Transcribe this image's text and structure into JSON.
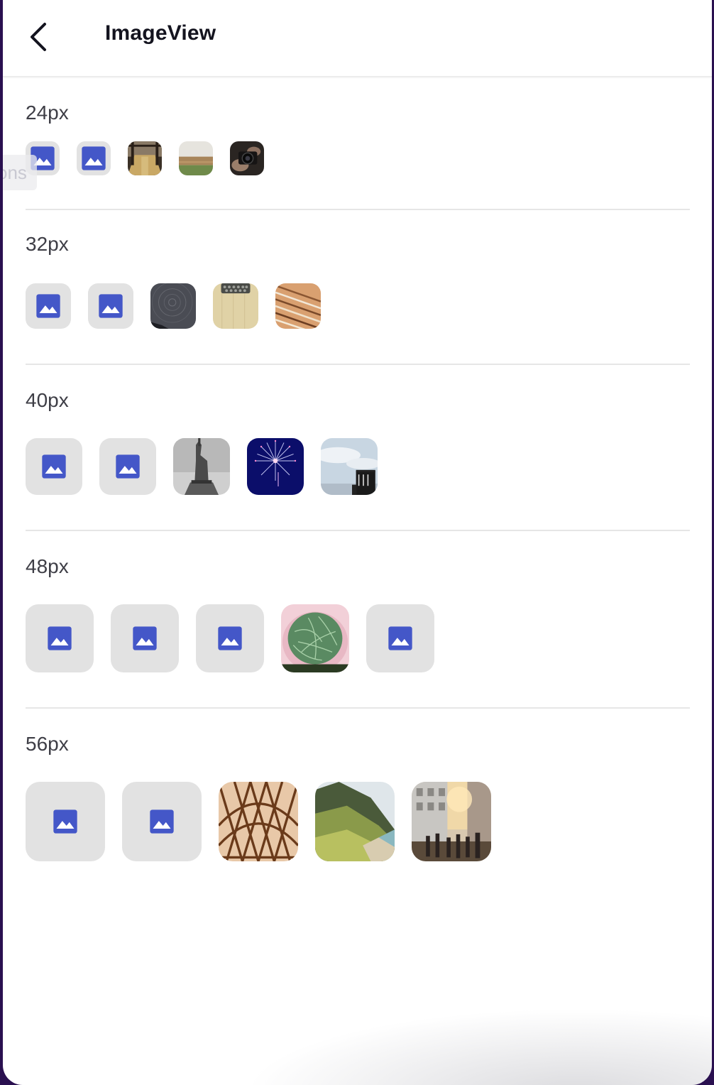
{
  "header": {
    "title": "ImageView",
    "back_icon": "chevron-left-icon"
  },
  "side_tab": {
    "text": "ons"
  },
  "colors": {
    "placeholder_icon": "#4457c8",
    "placeholder_bg": "#e2e2e2",
    "divider": "#e6e6e6",
    "label_text": "#3e3e46",
    "title_text": "#14141f"
  },
  "sections": [
    {
      "label": "24px",
      "items": [
        {
          "kind": "placeholder",
          "icon": "image-icon"
        },
        {
          "kind": "placeholder",
          "icon": "image-icon"
        },
        {
          "kind": "photo",
          "subject": "pier"
        },
        {
          "kind": "photo",
          "subject": "field"
        },
        {
          "kind": "photo",
          "subject": "camera"
        }
      ]
    },
    {
      "label": "32px",
      "items": [
        {
          "kind": "placeholder",
          "icon": "image-icon"
        },
        {
          "kind": "placeholder",
          "icon": "image-icon"
        },
        {
          "kind": "photo",
          "subject": "star-trails"
        },
        {
          "kind": "photo",
          "subject": "typewriter"
        },
        {
          "kind": "photo",
          "subject": "pencils"
        }
      ]
    },
    {
      "label": "40px",
      "items": [
        {
          "kind": "placeholder",
          "icon": "image-icon"
        },
        {
          "kind": "placeholder",
          "icon": "image-icon"
        },
        {
          "kind": "photo",
          "subject": "statue"
        },
        {
          "kind": "photo",
          "subject": "fireworks"
        },
        {
          "kind": "photo",
          "subject": "sky-tower"
        }
      ]
    },
    {
      "label": "48px",
      "items": [
        {
          "kind": "placeholder",
          "icon": "image-icon"
        },
        {
          "kind": "placeholder",
          "icon": "image-icon"
        },
        {
          "kind": "placeholder",
          "icon": "image-icon"
        },
        {
          "kind": "photo",
          "subject": "leaves-in-hands"
        },
        {
          "kind": "placeholder",
          "icon": "image-icon"
        }
      ]
    },
    {
      "label": "56px",
      "items": [
        {
          "kind": "placeholder",
          "icon": "image-icon"
        },
        {
          "kind": "placeholder",
          "icon": "image-icon"
        },
        {
          "kind": "photo",
          "subject": "bridge"
        },
        {
          "kind": "photo",
          "subject": "coast"
        },
        {
          "kind": "photo",
          "subject": "street"
        }
      ]
    }
  ]
}
